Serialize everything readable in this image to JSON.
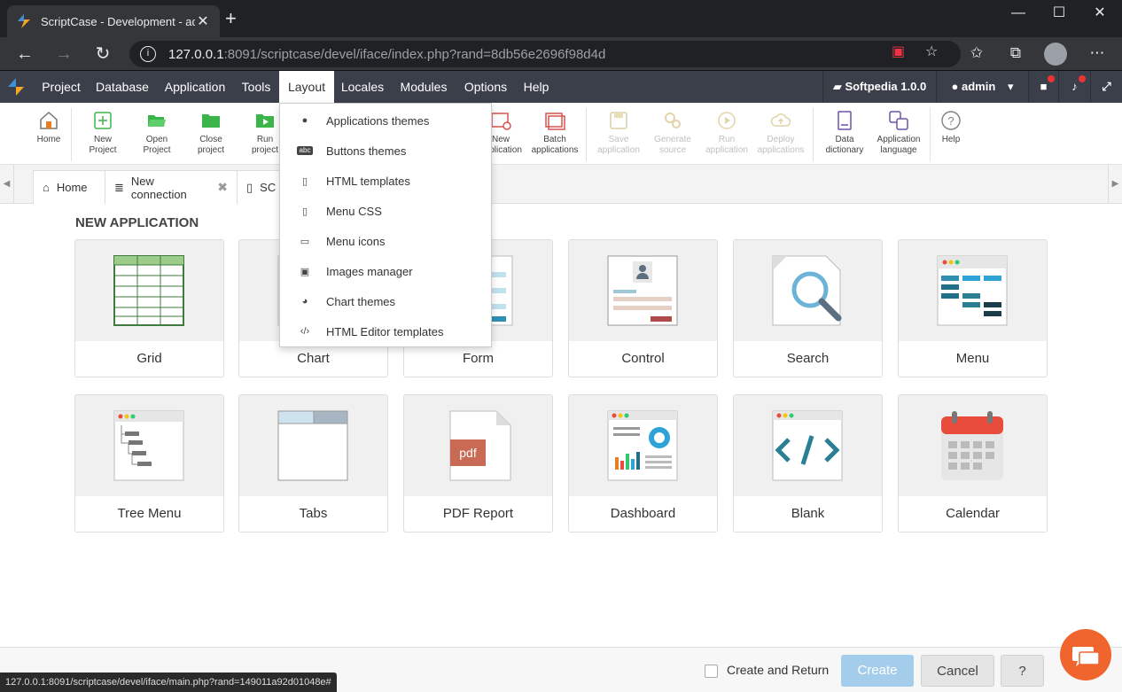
{
  "browser": {
    "tab_title": "ScriptCase - Development - adm",
    "tab_close": "✕",
    "new_tab": "+",
    "url_host": "127.0.0.1",
    "url_rest": ":8091/scriptcase/devel/iface/index.php?rand=8db56e2696f98d4d",
    "status_url": "127.0.0.1:8091/scriptcase/devel/iface/main.php?rand=149011a92d01048e#"
  },
  "menubar": {
    "items": [
      "Project",
      "Database",
      "Application",
      "Tools",
      "Layout",
      "Locales",
      "Modules",
      "Options",
      "Help"
    ],
    "active": "Layout",
    "project_name": "Softpedia 1.0.0",
    "user": "admin"
  },
  "toolbar": {
    "home": "Home",
    "new_project": [
      "New",
      "Project"
    ],
    "open_project": [
      "Open",
      "Project"
    ],
    "close_project": [
      "Close",
      "project"
    ],
    "run_project": [
      "Run",
      "project"
    ],
    "new_application": [
      "New",
      "application"
    ],
    "batch_applications": [
      "Batch",
      "applications"
    ],
    "save_application": [
      "Save",
      "application"
    ],
    "generate_source": [
      "Generate",
      "source"
    ],
    "run_application": [
      "Run",
      "application"
    ],
    "deploy_applications": [
      "Deploy",
      "applications"
    ],
    "data_dictionary": [
      "Data",
      "dictionary"
    ],
    "application_language": [
      "Application",
      "language"
    ],
    "help": "Help"
  },
  "tabs": {
    "home": "Home",
    "new_connection": "New connection",
    "third": "SC"
  },
  "layout_menu": [
    {
      "label": "Applications themes",
      "icon": "palette-icon"
    },
    {
      "label": "Buttons themes",
      "icon": "abc-icon"
    },
    {
      "label": "HTML templates",
      "icon": "html-file-icon"
    },
    {
      "label": "Menu CSS",
      "icon": "css-file-icon"
    },
    {
      "label": "Menu icons",
      "icon": "dashed-square-icon"
    },
    {
      "label": "Images manager",
      "icon": "image-icon"
    },
    {
      "label": "Chart themes",
      "icon": "pie-chart-icon"
    },
    {
      "label": "HTML Editor templates",
      "icon": "code-icon"
    }
  ],
  "main": {
    "section_title": "NEW APPLICATION",
    "cards": [
      "Grid",
      "Chart",
      "Form",
      "Control",
      "Search",
      "Menu",
      "Tree Menu",
      "Tabs",
      "PDF Report",
      "Dashboard",
      "Blank",
      "Calendar"
    ],
    "pdf_badge": "pdf"
  },
  "footer": {
    "create_and_return": "Create and Return",
    "create": "Create",
    "cancel": "Cancel",
    "help": "?"
  },
  "colors": {
    "menubar": "#3a3f4a",
    "create_button": "#a3cdea",
    "chat_bubble": "#f0642e"
  }
}
